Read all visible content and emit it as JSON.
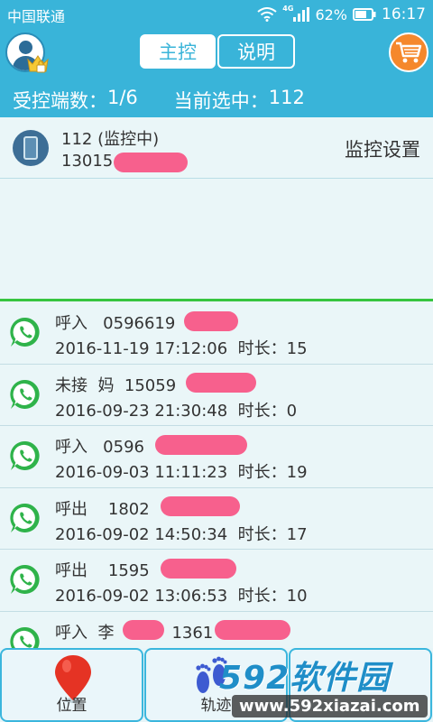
{
  "status_bar": {
    "carrier": "中国联通",
    "network": "4G",
    "battery": "62%",
    "time": "16:17"
  },
  "header": {
    "tabs": [
      {
        "label": "主控",
        "active": true
      },
      {
        "label": "说明",
        "active": false
      }
    ],
    "controlled_count_label": "受控端数：",
    "controlled_count": "1/6",
    "selected_label": "当前选中：",
    "selected_value": "112"
  },
  "device": {
    "name": "112 (监控中)",
    "number": "13015",
    "settings_label": "监控设置"
  },
  "calls": [
    {
      "line1": "呼入   0596619",
      "line2": "2016-11-19 17:12:06  时长：15"
    },
    {
      "line1": "未接  妈  15059",
      "line2": "2016-09-23 21:30:48  时长：0"
    },
    {
      "line1": "呼入   0596",
      "line2": "2016-09-03 11:11:23  时长：19"
    },
    {
      "line1": "呼出    1802",
      "line2": "2016-09-02 14:50:34  时长：17"
    },
    {
      "line1": "呼出    1595",
      "line2": "2016-09-02 13:06:53  时长：10"
    },
    {
      "line1": "呼入  李",
      "line2": ""
    }
  ],
  "call_extra": {
    "li_number": "1361"
  },
  "bottom_nav": [
    {
      "label": "位置",
      "icon": "location-pin-icon"
    },
    {
      "label": "轨迹",
      "icon": "footprints-icon"
    },
    {
      "label": "",
      "icon": "more-icon"
    }
  ],
  "watermark": {
    "brand": "592软件园",
    "url": "www.592xiazai.com"
  },
  "colors": {
    "header": "#39b4d9",
    "accent_green": "#37c53f",
    "redaction": "#f7608d",
    "cart": "#f5882c"
  }
}
